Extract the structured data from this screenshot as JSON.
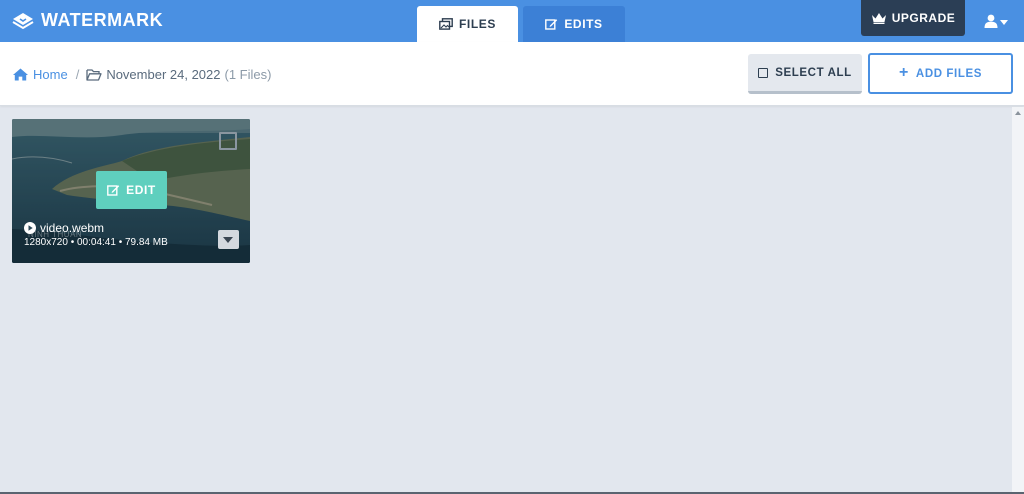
{
  "app": {
    "logo_text": "WATERMARK"
  },
  "tabs": [
    {
      "label": "FILES",
      "active": true
    },
    {
      "label": "EDITS",
      "active": false
    }
  ],
  "header": {
    "upgrade_label": "UPGRADE"
  },
  "breadcrumb": {
    "home_label": "Home",
    "separator": "/",
    "folder_label": "November 24, 2022",
    "count_label": "(1 Files)"
  },
  "actions": {
    "select_all_label": "SELECT ALL",
    "add_files_label": "ADD FILES"
  },
  "files": [
    {
      "name": "video.webm",
      "meta": "1280x720 • 00:04:41 • 79.84 MB",
      "edit_label": "EDIT",
      "watermark_text": "NINH THUAN"
    }
  ],
  "colors": {
    "primary": "#4a90e2",
    "dark": "#2b3e55",
    "edit_accent": "#5fcfbe",
    "background": "#e2e7ee"
  }
}
